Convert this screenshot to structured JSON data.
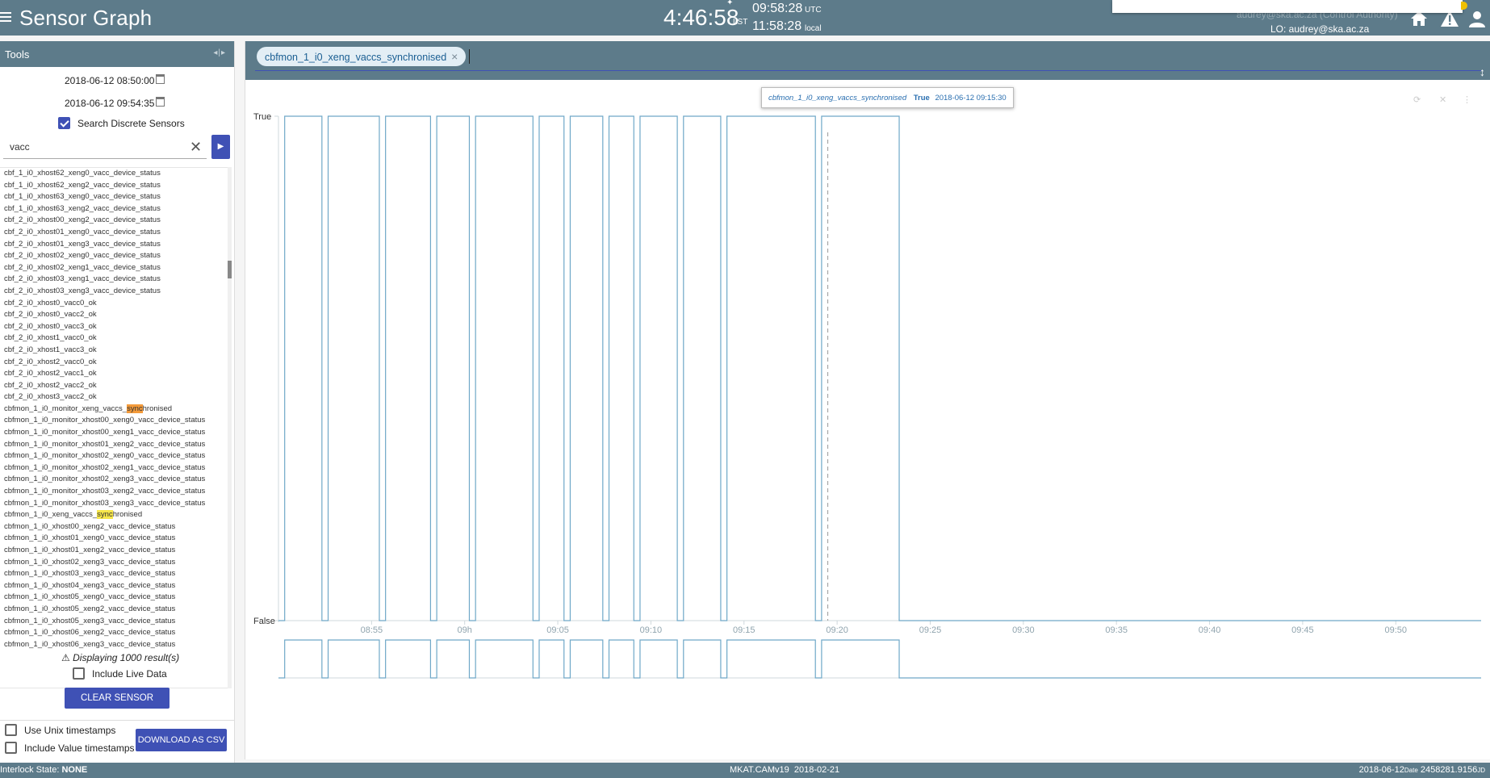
{
  "header": {
    "title": "Sensor Graph",
    "lst_time": "4:46:58",
    "lst_label": "LST",
    "utc_time": "09:58:28",
    "utc_label": "UTC",
    "local_time": "11:58:28",
    "local_label": "local",
    "user_faded": "audrey@ska.ac.za (Control Authority)",
    "lo_user": "LO: audrey@ska.ac.za"
  },
  "tools": {
    "title": "Tools",
    "start_date": "2018-06-12 08:50:00",
    "end_date": "2018-06-12 09:54:35",
    "search_discrete_label": "Search Discrete Sensors",
    "search_discrete_checked": true,
    "search_value": "vacc",
    "results": [
      {
        "pre": "cbf_1_i0_xhost62_xeng0_vacc_device_status"
      },
      {
        "pre": "cbf_1_i0_xhost62_xeng2_vacc_device_status"
      },
      {
        "pre": "cbf_1_i0_xhost63_xeng0_vacc_device_status"
      },
      {
        "pre": "cbf_1_i0_xhost63_xeng2_vacc_device_status"
      },
      {
        "pre": "cbf_2_i0_xhost00_xeng2_vacc_device_status"
      },
      {
        "pre": "cbf_2_i0_xhost01_xeng0_vacc_device_status"
      },
      {
        "pre": "cbf_2_i0_xhost01_xeng3_vacc_device_status"
      },
      {
        "pre": "cbf_2_i0_xhost02_xeng0_vacc_device_status"
      },
      {
        "pre": "cbf_2_i0_xhost02_xeng1_vacc_device_status"
      },
      {
        "pre": "cbf_2_i0_xhost03_xeng1_vacc_device_status"
      },
      {
        "pre": "cbf_2_i0_xhost03_xeng3_vacc_device_status"
      },
      {
        "pre": "cbf_2_i0_xhost0_vacc0_ok"
      },
      {
        "pre": "cbf_2_i0_xhost0_vacc2_ok"
      },
      {
        "pre": "cbf_2_i0_xhost0_vacc3_ok"
      },
      {
        "pre": "cbf_2_i0_xhost1_vacc0_ok"
      },
      {
        "pre": "cbf_2_i0_xhost1_vacc3_ok"
      },
      {
        "pre": "cbf_2_i0_xhost2_vacc0_ok"
      },
      {
        "pre": "cbf_2_i0_xhost2_vacc1_ok"
      },
      {
        "pre": "cbf_2_i0_xhost2_vacc2_ok"
      },
      {
        "pre": "cbf_2_i0_xhost3_vacc2_ok"
      },
      {
        "pre": "cbfmon_1_i0_monitor_xeng_vaccs_",
        "hl": "sync",
        "post": "hronised",
        "strong": true
      },
      {
        "pre": "cbfmon_1_i0_monitor_xhost00_xeng0_vacc_device_status"
      },
      {
        "pre": "cbfmon_1_i0_monitor_xhost00_xeng1_vacc_device_status"
      },
      {
        "pre": "cbfmon_1_i0_monitor_xhost01_xeng2_vacc_device_status"
      },
      {
        "pre": "cbfmon_1_i0_monitor_xhost02_xeng0_vacc_device_status"
      },
      {
        "pre": "cbfmon_1_i0_monitor_xhost02_xeng1_vacc_device_status"
      },
      {
        "pre": "cbfmon_1_i0_monitor_xhost02_xeng3_vacc_device_status"
      },
      {
        "pre": "cbfmon_1_i0_monitor_xhost03_xeng2_vacc_device_status"
      },
      {
        "pre": "cbfmon_1_i0_monitor_xhost03_xeng3_vacc_device_status"
      },
      {
        "pre": "cbfmon_1_i0_xeng_vaccs_",
        "hl": "sync",
        "post": "hronised"
      },
      {
        "pre": "cbfmon_1_i0_xhost00_xeng2_vacc_device_status"
      },
      {
        "pre": "cbfmon_1_i0_xhost01_xeng0_vacc_device_status"
      },
      {
        "pre": "cbfmon_1_i0_xhost01_xeng2_vacc_device_status"
      },
      {
        "pre": "cbfmon_1_i0_xhost02_xeng3_vacc_device_status"
      },
      {
        "pre": "cbfmon_1_i0_xhost03_xeng3_vacc_device_status"
      },
      {
        "pre": "cbfmon_1_i0_xhost04_xeng3_vacc_device_status"
      },
      {
        "pre": "cbfmon_1_i0_xhost05_xeng0_vacc_device_status"
      },
      {
        "pre": "cbfmon_1_i0_xhost05_xeng2_vacc_device_status"
      },
      {
        "pre": "cbfmon_1_i0_xhost05_xeng3_vacc_device_status"
      },
      {
        "pre": "cbfmon_1_i0_xhost06_xeng2_vacc_device_status"
      },
      {
        "pre": "cbfmon_1_i0_xhost06_xeng3_vacc_device_status"
      }
    ],
    "result_warning": "Displaying 1000 result(s)",
    "include_live_label": "Include Live Data",
    "include_live_checked": false,
    "clear_button": "CLEAR SENSOR GRAPH",
    "unix_ts_label": "Use Unix timestamps",
    "unix_ts_checked": false,
    "value_ts_label": "Include Value timestamps",
    "value_ts_checked": false,
    "csv_button": "DOWNLOAD AS CSV"
  },
  "graph": {
    "sensor_chip": "cbfmon_1_i0_xeng_vaccs_synchronised",
    "tooltip": {
      "name": "cbfmon_1_i0_xeng_vaccs_synchronised",
      "value": "True",
      "time": "2018-06-12 09:15:30"
    }
  },
  "chart_data": {
    "type": "line",
    "step": true,
    "series": [
      {
        "name": "cbfmon_1_i0_xeng_vaccs_synchronised"
      }
    ],
    "y_categories": [
      "False",
      "True"
    ],
    "x_ticks": [
      "08:55",
      "09h",
      "09:05",
      "09:10",
      "09:15",
      "09:20",
      "09:25",
      "09:30",
      "09:35",
      "09:40",
      "09:45",
      "09:50"
    ],
    "xlim": [
      "2018-06-12 08:50:00",
      "2018-06-12 09:54:35"
    ],
    "true_intervals": [
      [
        "08:50:20",
        "08:52:20"
      ],
      [
        "08:52:40",
        "08:55:25"
      ],
      [
        "08:55:45",
        "08:58:10"
      ],
      [
        "08:58:30",
        "09:00:15"
      ],
      [
        "09:00:35",
        "09:03:40"
      ],
      [
        "09:04:00",
        "09:05:20"
      ],
      [
        "09:05:40",
        "09:07:25"
      ],
      [
        "09:07:45",
        "09:09:05"
      ],
      [
        "09:09:25",
        "09:11:25"
      ],
      [
        "09:11:45",
        "09:13:45"
      ],
      [
        "09:14:05",
        "09:18:50"
      ],
      [
        "09:19:10",
        "09:23:20"
      ]
    ],
    "hover_time": "09:19:30",
    "grid": false,
    "navigator": true
  },
  "footer": {
    "interlock_label": "Interlock State:",
    "interlock_value": "NONE",
    "version": "MKAT.CAMv19",
    "version_date": "2018-02-21",
    "date": "2018-06-12",
    "date_label": "Date",
    "jd": "2458281.9156",
    "jd_label": "JD"
  },
  "colors": {
    "header": "#5d7b8a",
    "accent": "#3f51b5",
    "series": "#6fa8c8",
    "highlight": "#f6e64a",
    "highlight_strong": "#f39a3a"
  }
}
